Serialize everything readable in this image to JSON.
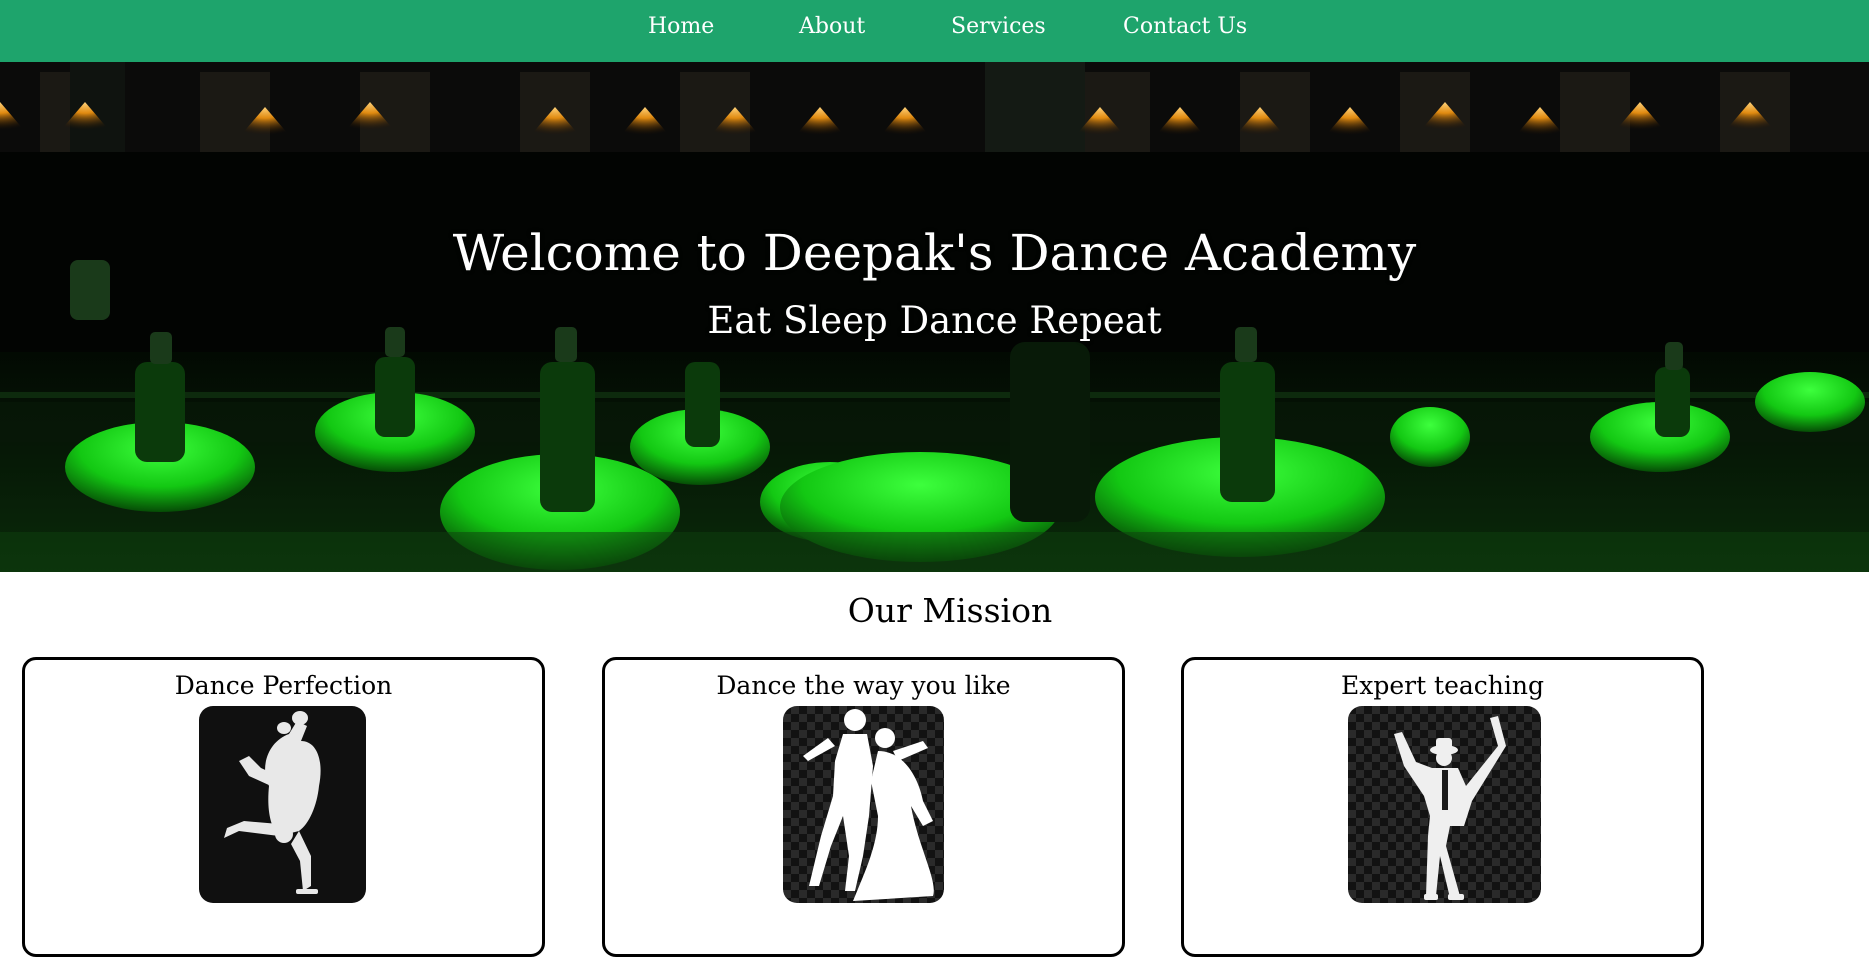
{
  "nav": {
    "items": [
      {
        "label": "Home"
      },
      {
        "label": "About"
      },
      {
        "label": "Services"
      },
      {
        "label": "Contact Us"
      }
    ]
  },
  "hero": {
    "title": "Welcome to Deepak's Dance Academy",
    "subtitle": "Eat Sleep Dance Repeat"
  },
  "mission": {
    "heading": "Our Mission",
    "cards": [
      {
        "title": "Dance Perfection",
        "icon": "breakdancer-silhouette-icon"
      },
      {
        "title": "Dance the way you like",
        "icon": "ballroom-couple-silhouette-icon"
      },
      {
        "title": "Expert teaching",
        "icon": "dancer-hat-silhouette-icon"
      }
    ]
  },
  "colors": {
    "nav_bg": "#1ea46c",
    "hero_accent": "#1cd21c",
    "text_light": "#ffffff",
    "text_dark": "#000000"
  }
}
